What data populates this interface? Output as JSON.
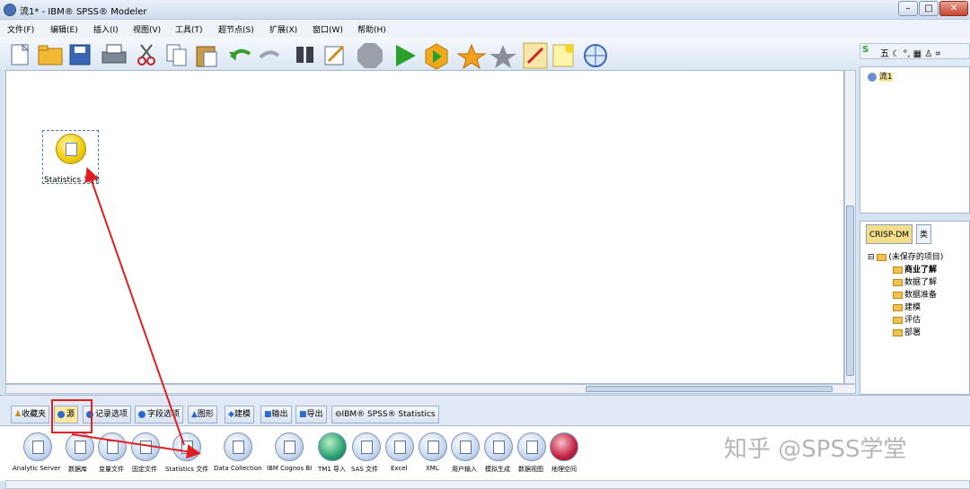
{
  "window": {
    "title": "流1* - IBM® SPSS® Modeler",
    "minimize": "–",
    "maximize": "□",
    "close": "✕"
  },
  "menu": [
    "文件(F)",
    "编辑(E)",
    "插入(I)",
    "视图(V)",
    "工具(T)",
    "超节点(S)",
    "扩展(X)",
    "窗口(W)",
    "帮助(H)"
  ],
  "toolbar_icons": [
    "new-file-icon",
    "open-folder-icon",
    "save-icon",
    "print-icon",
    "cut-icon",
    "copy-icon",
    "paste-icon",
    "undo-icon",
    "redo-icon",
    "find-icon",
    "edit-icon",
    "stop-icon",
    "run-icon",
    "run-selection-icon",
    "highlight-star-icon",
    "star-icon",
    "annotation-icon",
    "new-note-icon",
    "web-icon"
  ],
  "ime": {
    "text": "五 ☾ °, ▦ ♙ ⌗"
  },
  "canvas": {
    "node_label": "Statistics 文件"
  },
  "streams": {
    "item": "流1"
  },
  "crisp": {
    "tab1": "CRISP-DM",
    "tab2": "类",
    "root": "(未保存的项目)",
    "items": [
      "商业了解",
      "数据了解",
      "数据准备",
      "建模",
      "评估",
      "部署"
    ]
  },
  "palette_tabs": [
    "收藏夹",
    "源",
    "记录选项",
    "字段选项",
    "图形",
    "建模",
    "输出",
    "导出",
    "IBM® SPSS® Statistics"
  ],
  "palette_nodes": [
    "Analytic Server",
    "数据库",
    "变量文件",
    "固定文件",
    "Statistics 文件",
    "Data Collection",
    "IBM Cognos BI",
    "TM1 导入",
    "SAS 文件",
    "Excel",
    "XML",
    "用户输入",
    "模拟生成",
    "数据视图",
    "地理空间"
  ],
  "watermark": "知乎 @SPSS学堂",
  "colors": {
    "arrow": "#e02020",
    "node_fill": "#f3cf11",
    "run_green": "#2aa02a"
  }
}
